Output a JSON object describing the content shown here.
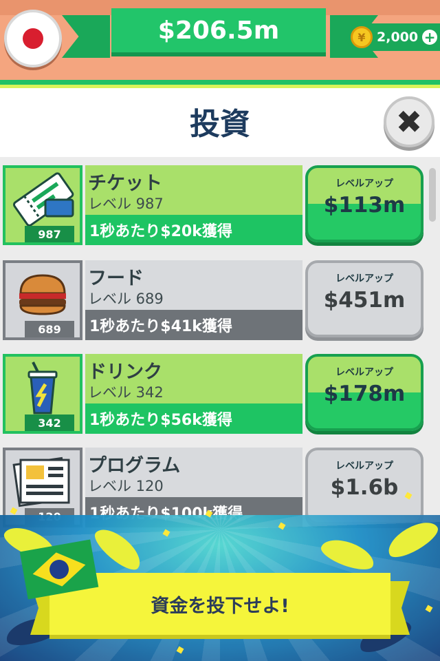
{
  "header": {
    "money": "$206.5m",
    "coins": "2,000",
    "coin_icon": "coin-icon",
    "flag": "japan-flag-icon"
  },
  "page": {
    "title": "投資",
    "close_icon": "close-icon"
  },
  "investments": [
    {
      "name": "チケット",
      "level": "レベル 987",
      "level_badge": "987",
      "earn": "1秒あたり$20k獲得",
      "button_label": "レベルアップ",
      "cost": "$113m",
      "state": "affordable",
      "icon": "ticket-icon"
    },
    {
      "name": "フード",
      "level": "レベル 689",
      "level_badge": "689",
      "earn": "1秒あたり$41k獲得",
      "button_label": "レベルアップ",
      "cost": "$451m",
      "state": "locked",
      "icon": "burger-icon"
    },
    {
      "name": "ドリンク",
      "level": "レベル 342",
      "level_badge": "342",
      "earn": "1秒あたり$56k獲得",
      "button_label": "レベルアップ",
      "cost": "$178m",
      "state": "affordable",
      "icon": "drink-cup-icon"
    },
    {
      "name": "プログラム",
      "level": "レベル 120",
      "level_badge": "120",
      "earn": "1秒あたり$100k獲得",
      "button_label": "レベルアップ",
      "cost": "$1.6b",
      "state": "locked",
      "icon": "newspaper-icon"
    }
  ],
  "promo": {
    "cta": "資金を投下せよ!",
    "flag": "brazil-flag-icon"
  },
  "colors": {
    "green": "#22c56a",
    "light_green": "#a9e06a",
    "navy": "#1d3b5e",
    "yellow": "#f5f53b"
  }
}
